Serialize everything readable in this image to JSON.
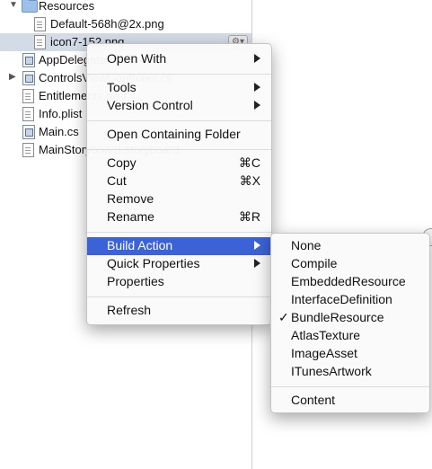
{
  "tree": {
    "folder": "Resources",
    "files": [
      "Default-568h@2x.png",
      "icon7-152.png",
      "AppDelegate.cs",
      "ControlsViewController.cs",
      "Entitlements.plist",
      "Info.plist",
      "Main.cs",
      "MainStoryboard.storyboard"
    ]
  },
  "context_menu": {
    "open_with": "Open With",
    "tools": "Tools",
    "version_control": "Version Control",
    "open_containing_folder": "Open Containing Folder",
    "copy": "Copy",
    "copy_shortcut": "⌘C",
    "cut": "Cut",
    "cut_shortcut": "⌘X",
    "remove": "Remove",
    "rename": "Rename",
    "rename_shortcut": "⌘R",
    "build_action": "Build Action",
    "quick_properties": "Quick Properties",
    "properties": "Properties",
    "refresh": "Refresh"
  },
  "build_action_menu": {
    "items": [
      "None",
      "Compile",
      "EmbeddedResource",
      "InterfaceDefinition",
      "BundleResource",
      "AtlasTexture",
      "ImageAsset",
      "ITunesArtwork"
    ],
    "checked": "BundleResource",
    "extra": "Content",
    "check_mark": "✓"
  },
  "colors": {
    "highlight": "#3b62d6",
    "selected_row": "#d3dbe6"
  }
}
